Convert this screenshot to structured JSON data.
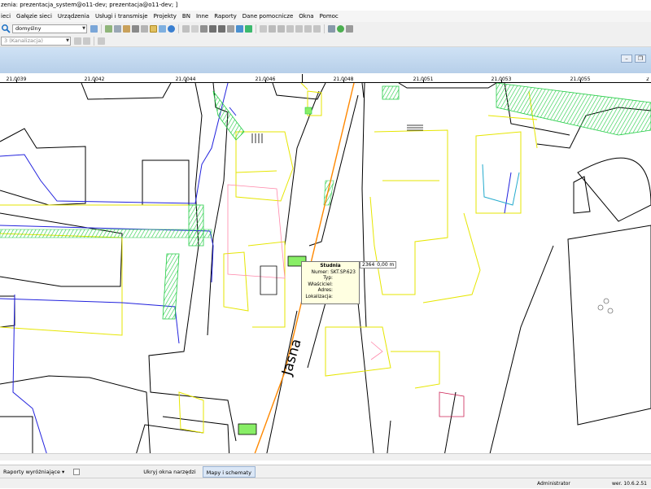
{
  "window": {
    "title": "zenia: prezentacja_system@o11-dev; prezentacja@o11-dev; ]"
  },
  "menu": [
    "ieci",
    "Gałęzie sieci",
    "Urządzenia",
    "Usługi i transmisje",
    "Projekty",
    "BN",
    "Inne",
    "Raporty",
    "Dane pomocnicze",
    "Okna",
    "Pomoc"
  ],
  "toolbar": {
    "profile_select": "domyślny",
    "layer_select": "3 (Kanalizacja)"
  },
  "ruler": {
    "ticks": [
      "21,0039",
      "21,0042",
      "21,0044",
      "21,0046",
      "21,0048",
      "21,0051",
      "21,0053",
      "21,0055"
    ]
  },
  "map": {
    "street_label": "Jasna"
  },
  "tooltip": {
    "title": "Studnia",
    "rows": [
      {
        "label": "Numer:",
        "value": "SKT.SP.623"
      },
      {
        "label": "Typ:",
        "value": ""
      },
      {
        "label": "Właściciel:",
        "value": ""
      },
      {
        "label": "Adres:",
        "value": ""
      },
      {
        "label": "Lokalizacja:",
        "value": ""
      }
    ]
  },
  "coords": {
    "value": "2364",
    "height": "0,00 m"
  },
  "tabs": {
    "reports": "Raporty wyróżniające",
    "hide_tools": "Ukryj okna narzędzi",
    "maps": "Mapy i schematy"
  },
  "status": {
    "user": "Administrator",
    "version": "wer. 10.6.2.51"
  },
  "colors": {
    "street_black": "#000000",
    "building_yellow": "#e6e600",
    "network_blue": "#2222dd",
    "hatch_green": "#22cc44",
    "cable_orange": "#ff8800",
    "pink_lines": "#ff88aa",
    "well_green": "#88ee66"
  }
}
